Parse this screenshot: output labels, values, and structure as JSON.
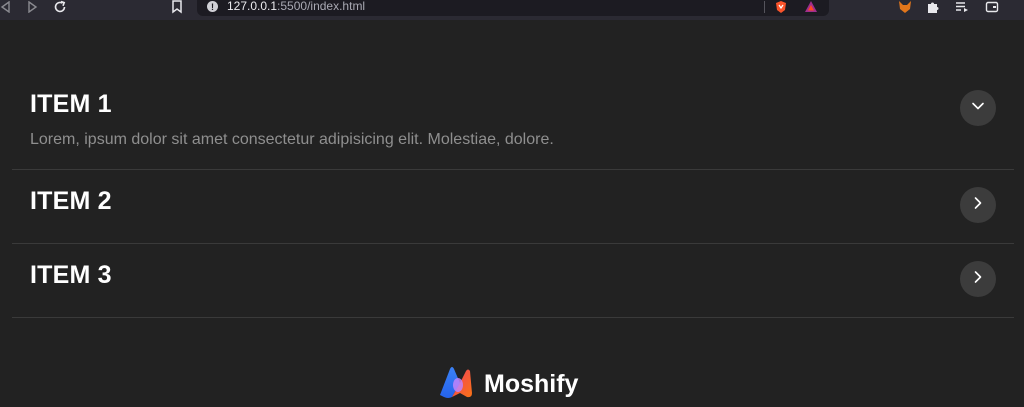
{
  "browser": {
    "url_host": "127.0.0.1",
    "url_rest": ":5500/index.html"
  },
  "accordion": {
    "items": [
      {
        "title": "ITEM 1",
        "description": "Lorem, ipsum dolor sit amet consectetur adipisicing elit. Molestiae, dolore.",
        "expanded": true,
        "toggle_icon": "chevron-down-icon"
      },
      {
        "title": "ITEM 2",
        "expanded": false,
        "toggle_icon": "chevron-right-icon"
      },
      {
        "title": "ITEM 3",
        "expanded": false,
        "toggle_icon": "chevron-right-icon"
      }
    ]
  },
  "footer": {
    "brand_name": "Moshify",
    "logo_icon": "moshify-logo-icon"
  },
  "colors": {
    "background": "#222222",
    "divider": "#3a3a3a",
    "toggle_bg": "#3c3c3c",
    "description": "#8f8f8f"
  }
}
